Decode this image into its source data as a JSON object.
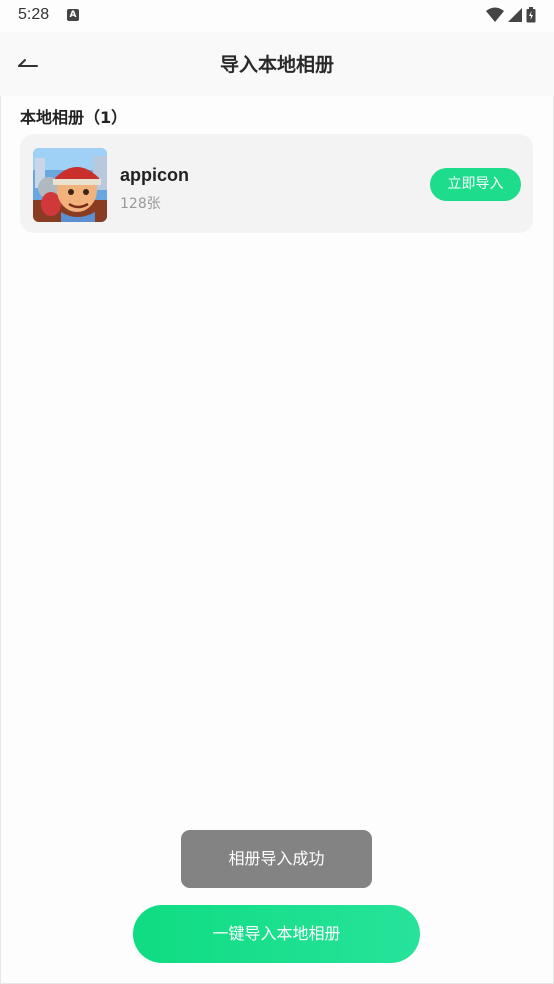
{
  "status_bar": {
    "time": "5:28",
    "notification_letter": "A",
    "icons": [
      "wifi-icon",
      "signal-icon",
      "battery-icon"
    ]
  },
  "nav": {
    "title": "导入本地相册",
    "back_icon": "back-arrow-icon"
  },
  "section": {
    "title": "本地相册（1）"
  },
  "albums": [
    {
      "name": "appicon",
      "count": "128张",
      "button_label": "立即导入",
      "thumbnail_icon": "game-app-icon"
    }
  ],
  "toast": {
    "message": "相册导入成功"
  },
  "bottom_button": {
    "label": "一键导入本地相册"
  },
  "colors": {
    "accent": "#1ddc8c",
    "toast_bg": "#838383",
    "card_bg": "#f3f3f3"
  }
}
